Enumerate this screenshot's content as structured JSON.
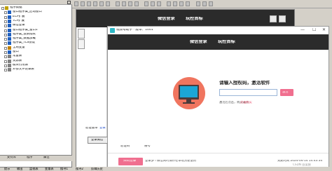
{
  "ide": {
    "tree_title": "程序数据",
    "tree_items": [
      {
        "label": "程序数据",
        "level": 0,
        "color": "#c0a000"
      },
      {
        "label": "窗口程序集_启动窗口",
        "level": 1,
        "color": "#2060c0"
      },
      {
        "label": "ECP扩展",
        "level": 1,
        "color": "#2060c0"
      },
      {
        "label": "TCP扩展",
        "level": 1,
        "color": "#2060c0"
      },
      {
        "label": "微信登录",
        "level": 1,
        "color": "#2060c0"
      },
      {
        "label": "窗口程序集_窗口1",
        "level": 1,
        "color": "#2060c0"
      },
      {
        "label": "程序集_会员授权",
        "level": 1,
        "color": "#2060c0"
      },
      {
        "label": "程序集_数据加载",
        "level": 1,
        "color": "#2060c0"
      },
      {
        "label": "程序集_TLS协议",
        "level": 1,
        "color": "#2060c0"
      },
      {
        "label": "全局变量",
        "level": 1,
        "color": "#c08000"
      },
      {
        "label": "窗口",
        "level": 1,
        "color": "#2060c0"
      },
      {
        "label": "常量表",
        "level": 1,
        "color": "#808080"
      },
      {
        "label": "资源表",
        "level": 1,
        "color": "#808080"
      },
      {
        "label": "模块引用表",
        "level": 1,
        "color": "#808080"
      },
      {
        "label": "外部文件记录表",
        "level": 1,
        "color": "#808080"
      }
    ],
    "left_tabs": [
      "支持库",
      "程序",
      "属性"
    ],
    "bottom_tabs": [
      "提示",
      "输出",
      "监视表",
      "变量表",
      "搜寻1",
      "搜寻2",
      "剪辑历史"
    ]
  },
  "designer": {
    "nav": [
      "微信登录",
      "玩控首标"
    ]
  },
  "app": {
    "title": "视频号助手 · 版本：1001",
    "nav": [
      "微信登录",
      "玩控首标"
    ],
    "prompt": "请输入授权码，激活软件",
    "input_value": "",
    "activate_button": "激活",
    "hint_text": "激活后点击，购买请点",
    "hint_link": "点击购买",
    "login_button": "扫码登录",
    "login_desc": "登录多个微信同时保存在本地方便使用",
    "expire_text": "到期时间 2024-04-14 14:43:34",
    "verify_code_label": "验证码",
    "account_label": "账号"
  },
  "inner": {
    "verify_code": "验证版本",
    "login_small": "登录",
    "login_wx": "登录微信"
  },
  "watermark": "CSDN @某猿"
}
